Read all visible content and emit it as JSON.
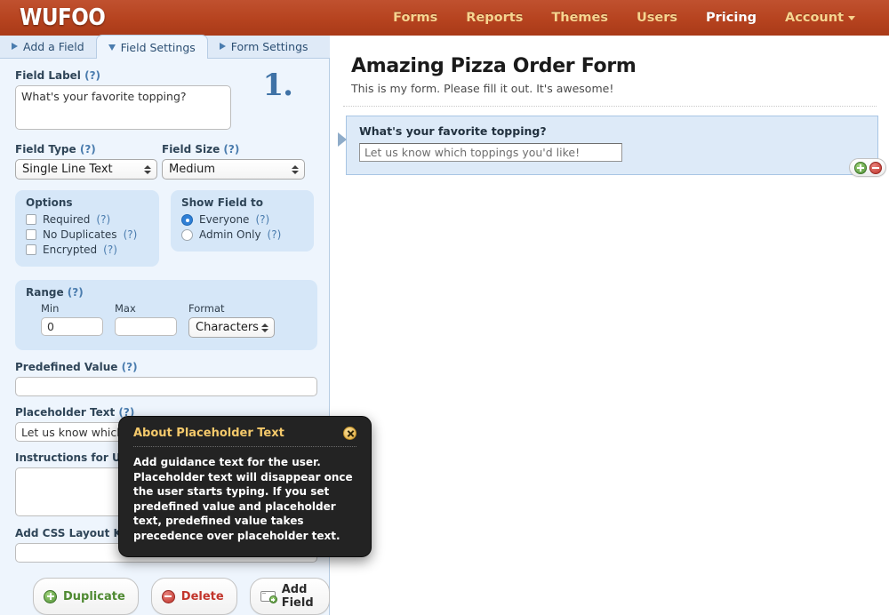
{
  "header": {
    "logo": "WUFOO",
    "nav": [
      {
        "label": "Forms",
        "active": false
      },
      {
        "label": "Reports",
        "active": false
      },
      {
        "label": "Themes",
        "active": false
      },
      {
        "label": "Users",
        "active": false
      },
      {
        "label": "Pricing",
        "active": true
      },
      {
        "label": "Account",
        "active": false,
        "caret": true
      }
    ],
    "brand_color": "#b6431f",
    "nav_color": "#f6d48f"
  },
  "tabs": [
    {
      "label": "Add a Field",
      "marker": "triangle-right",
      "active": false
    },
    {
      "label": "Field Settings",
      "marker": "triangle-down",
      "active": true
    },
    {
      "label": "Form Settings",
      "marker": "triangle-right",
      "active": false
    }
  ],
  "field_settings": {
    "number_badge": "1.",
    "field_label": {
      "label": "Field Label",
      "help": "(?)",
      "value": "What's your favorite topping?"
    },
    "field_type": {
      "label": "Field Type",
      "help": "(?)",
      "value": "Single Line Text"
    },
    "field_size": {
      "label": "Field Size",
      "help": "(?)",
      "value": "Medium"
    },
    "options": {
      "title": "Options",
      "items": [
        {
          "label": "Required",
          "help": "(?)",
          "checked": false
        },
        {
          "label": "No Duplicates",
          "help": "(?)",
          "checked": false
        },
        {
          "label": "Encrypted",
          "help": "(?)",
          "checked": false
        }
      ]
    },
    "show_field_to": {
      "title": "Show Field to",
      "items": [
        {
          "label": "Everyone",
          "help": "(?)",
          "selected": true
        },
        {
          "label": "Admin Only",
          "help": "(?)",
          "selected": false
        }
      ]
    },
    "range": {
      "title": "Range",
      "help": "(?)",
      "min_label": "Min",
      "min_value": "0",
      "max_label": "Max",
      "max_value": "",
      "format_label": "Format",
      "format_value": "Characters"
    },
    "predefined_value": {
      "label": "Predefined Value",
      "help": "(?)",
      "value": ""
    },
    "placeholder_text": {
      "label": "Placeholder Text",
      "help": "(?)",
      "value": "Let us know which toppings you'd like!"
    },
    "instructions": {
      "label": "Instructions for Users",
      "help": "(?)",
      "value": ""
    },
    "css_layout_keyword": {
      "label": "Add CSS Layout Keyword",
      "help": "(?)",
      "value": ""
    },
    "buttons": [
      {
        "label": "Duplicate",
        "icon": "green-plus-circle-icon",
        "color": "#4f8a32"
      },
      {
        "label": "Delete",
        "icon": "red-minus-circle-icon",
        "color": "#c2352c"
      },
      {
        "label": "Add Field",
        "icon": "add-field-icon",
        "color": "#2b2b2b"
      }
    ]
  },
  "preview": {
    "title": "Amazing Pizza Order Form",
    "subtitle": "This is my form. Please fill it out. It's awesome!",
    "field": {
      "label": "What's your favorite topping?",
      "placeholder": "Let us know which toppings you'd like!"
    },
    "row_controls": {
      "add": "green-plus-circle-icon",
      "remove": "red-minus-circle-icon"
    }
  },
  "tooltip": {
    "title": "About Placeholder Text",
    "body": "Add guidance text for the user. Placeholder text will disappear once the user starts typing. If you set predefined value and placeholder text, predefined value takes precedence over placeholder text.",
    "close_icon": "close-circle-icon",
    "title_color": "#f4c96b",
    "background": "#232323"
  }
}
